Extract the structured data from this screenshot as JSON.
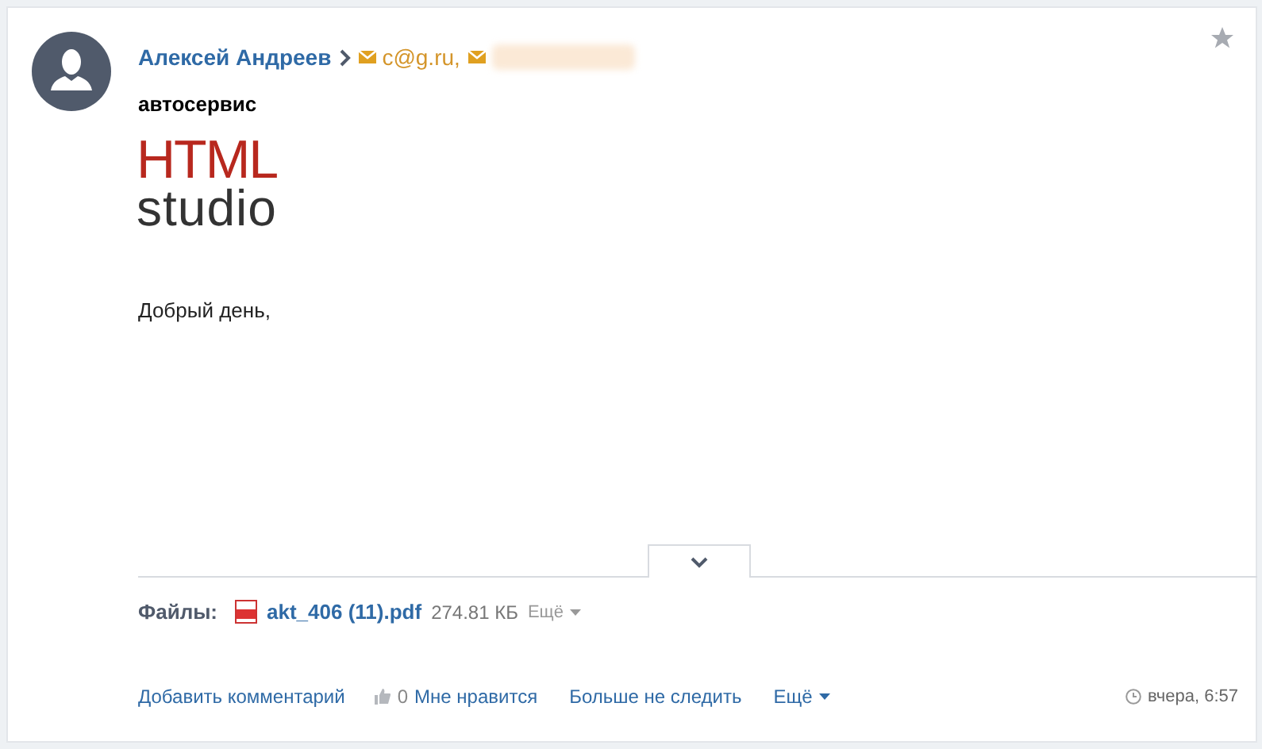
{
  "message": {
    "sender": "Алексей Андреев",
    "recipients": [
      {
        "address": "c@g.ru,",
        "redacted": false
      },
      {
        "redacted": true
      }
    ],
    "starred": false,
    "subject": "автосервис",
    "logo": {
      "top": "HTML",
      "bottom": "studio"
    },
    "body": "Добрый день,"
  },
  "files": {
    "label": "Файлы:",
    "items": [
      {
        "name": "akt_406 (11).pdf",
        "size": "274.81 КБ",
        "more": "Ещё"
      }
    ]
  },
  "actions": {
    "comment": "Добавить комментарий",
    "likes": "0",
    "like": "Мне нравится",
    "unfollow": "Больше не следить",
    "more": "Ещё",
    "time": "вчера, 6:57"
  }
}
